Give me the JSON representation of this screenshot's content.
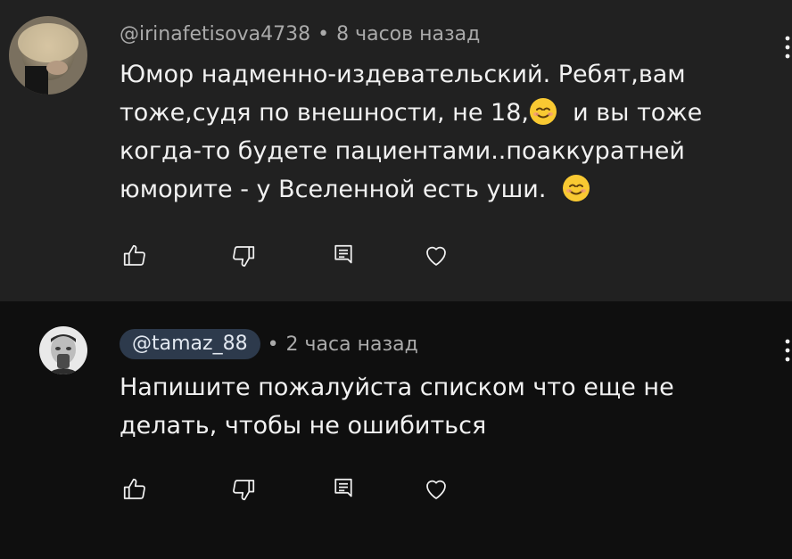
{
  "comments": [
    {
      "author": "@irinafetisova4738",
      "separator": "•",
      "time": "8 часов назад",
      "lines": [
        "Юмор  надменно-издевательский.  Ребят,вам",
        "тоже,судя по внешности, не 18,",
        "и вы тоже",
        "когда-то будете пациентами..поаккуратней",
        "юморите - у Вселенной есть уши."
      ],
      "emoji": "smiling-face-emoji"
    },
    {
      "author": "@tamaz_88",
      "separator": "•",
      "time": "2 часа назад",
      "lines": [
        "Напишите пожалуйста списком что еще не",
        "делать, чтобы не ошибиться"
      ]
    }
  ],
  "icons": {
    "like": "thumbs-up-icon",
    "dislike": "thumbs-down-icon",
    "reply": "reply-icon",
    "heart": "heart-icon",
    "more": "more-vert-icon"
  },
  "colors": {
    "highlight_background": "#212121",
    "background": "#0f0f0f",
    "author_pill": "#2d3a4c",
    "text": "#f1f1f1",
    "meta": "#aaaaaa"
  }
}
